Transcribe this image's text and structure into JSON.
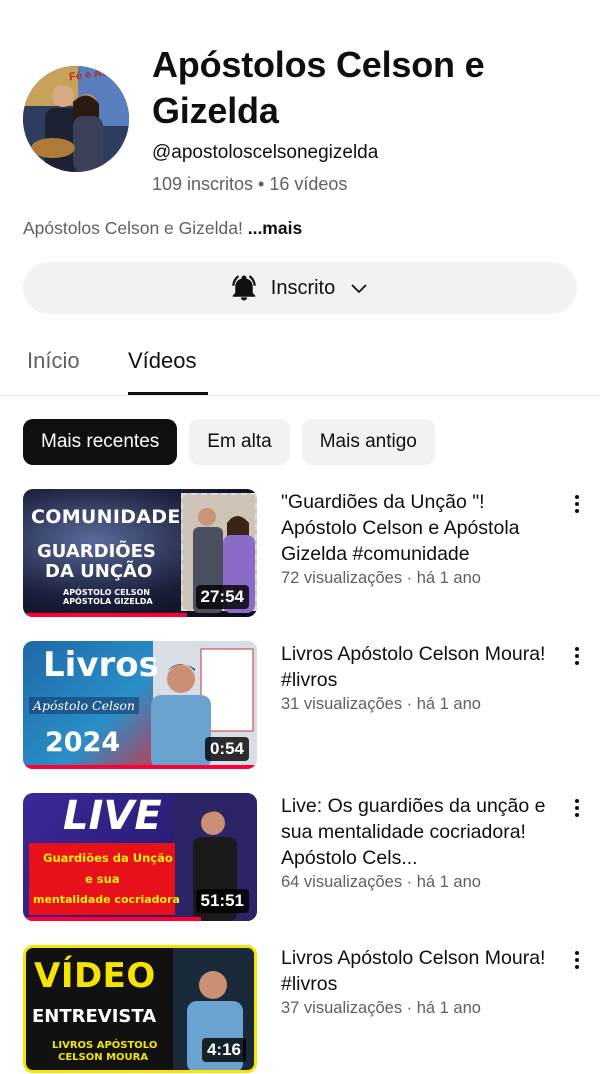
{
  "channel": {
    "name": "Apóstolos Celson e Gizelda",
    "handle": "@apostoloscelsonegizelda",
    "stats": "109 inscritos • 16 vídeos",
    "description": "Apóstolos Celson e Gizelda! ",
    "description_more": "...mais",
    "avatar_text": "Fé e Ativa"
  },
  "subscribe": {
    "label": "Inscrito",
    "icon": "bell-icon"
  },
  "tabs": [
    {
      "label": "Início",
      "active": false
    },
    {
      "label": "Vídeos",
      "active": true
    }
  ],
  "filters": [
    {
      "label": "Mais recentes",
      "active": true
    },
    {
      "label": "Em alta",
      "active": false
    },
    {
      "label": "Mais antigo",
      "active": false
    }
  ],
  "videos": [
    {
      "title": "\"Guardiões da Unção \"! Apóstolo Celson e Apóstola Gizelda #comunidade",
      "meta": "72 visualizações · há 1 ano",
      "duration": "27:54",
      "thumb_lines": [
        "COMUNIDADE",
        "GUARDIÕES",
        "DA UNÇÃO",
        "APÓSTOLO CELSON",
        "APÓSTOLA GIZELDA"
      ]
    },
    {
      "title": "Livros Apóstolo Celson Moura! #livros",
      "meta": "31 visualizações · há 1 ano",
      "duration": "0:54",
      "thumb_lines": [
        "Livros",
        "Apóstolo Celson",
        "2024"
      ]
    },
    {
      "title": "Live: Os guardiões da unção e sua mentalidade cocriadora! Apóstolo Cels...",
      "meta": "64 visualizações · há 1 ano",
      "duration": "51:51",
      "thumb_lines": [
        "LIVE",
        "Guardiões da Unção",
        "e sua",
        "mentalidade cocriadora"
      ]
    },
    {
      "title": "Livros Apóstolo Celson Moura! #livros",
      "meta": "37 visualizações · há 1 ano",
      "duration": "4:16",
      "thumb_lines": [
        "VÍDEO",
        "ENTREVISTA",
        "LIVROS APÓSTOLO",
        "CELSON MOURA"
      ]
    }
  ]
}
